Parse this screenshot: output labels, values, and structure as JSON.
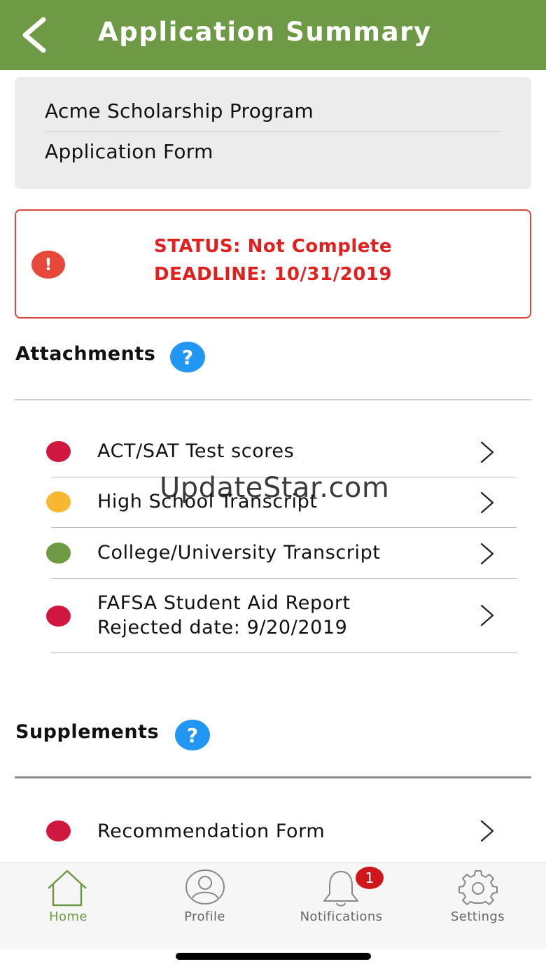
{
  "colors": {
    "brand": "#6f9a45",
    "status_red": "#e0201e",
    "help_blue": "#2196f3",
    "dot_red": "#d0173f",
    "dot_yellow": "#f7b731",
    "dot_green": "#6e9a44",
    "badge_red": "#d0161b"
  },
  "header": {
    "title": "Application Summary",
    "back_icon": "chevron-left-icon"
  },
  "program": {
    "name": "Acme Scholarship Program",
    "form": "Application Form"
  },
  "status": {
    "icon": "exclamation-icon",
    "status_line": "STATUS: Not Complete",
    "deadline_line": "DEADLINE: 10/31/2019"
  },
  "attachments": {
    "title": "Attachments",
    "help": "?",
    "items": [
      {
        "label": "ACT/SAT Test scores",
        "state": "red"
      },
      {
        "label": "High School Transcript",
        "state": "yellow"
      },
      {
        "label": "College/University Transcript",
        "state": "green"
      },
      {
        "label": "FAFSA Student Aid Report",
        "sub": "Rejected date: 9/20/2019",
        "state": "red"
      }
    ]
  },
  "supplements": {
    "title": "Supplements",
    "help": "?",
    "items": [
      {
        "label": "Recommendation Form",
        "state": "red"
      }
    ]
  },
  "watermark": "UpdateStar.com",
  "tabbar": {
    "tabs": [
      {
        "label": "Home",
        "icon": "home-icon",
        "active": true
      },
      {
        "label": "Profile",
        "icon": "user-icon",
        "active": false
      },
      {
        "label": "Notifications",
        "icon": "bell-icon",
        "active": false,
        "badge": "1"
      },
      {
        "label": "Settings",
        "icon": "gear-icon",
        "active": false
      }
    ]
  }
}
